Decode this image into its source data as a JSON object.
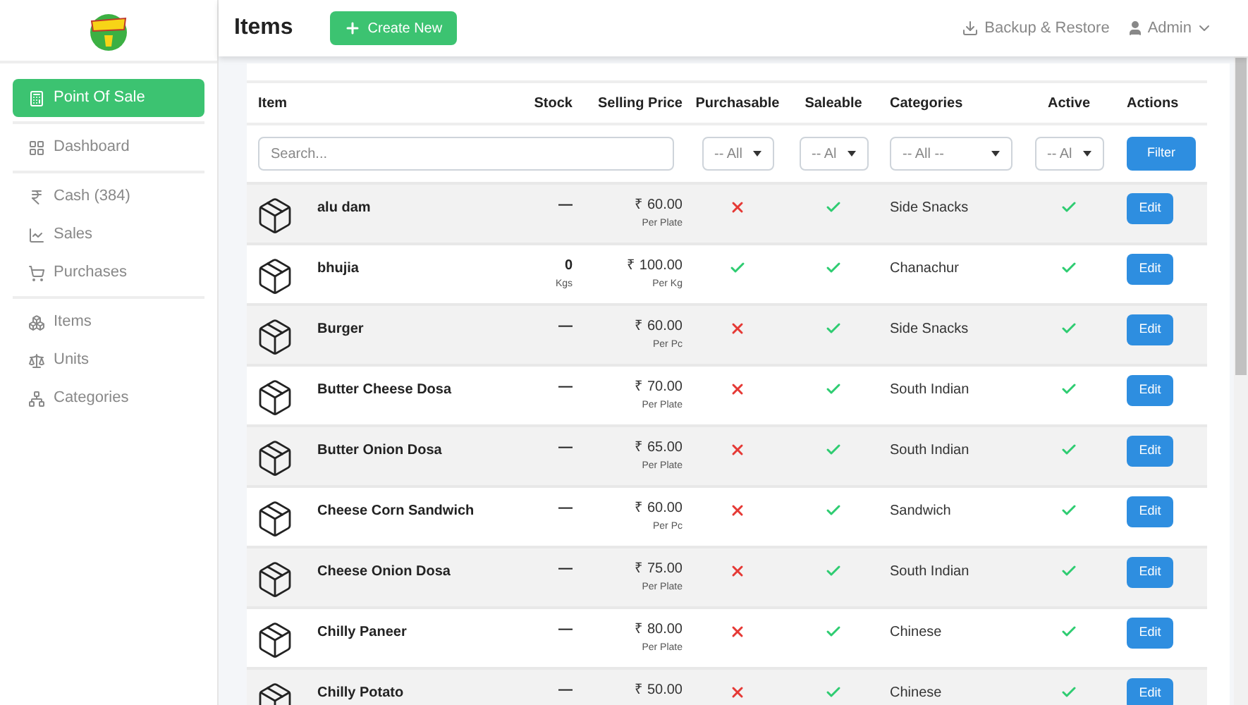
{
  "header": {
    "title": "Items",
    "create_button": "Create New",
    "backup_link": "Backup & Restore",
    "user_menu": "Admin"
  },
  "sidebar": {
    "groups": [
      {
        "items": [
          {
            "label": "Point Of Sale",
            "selected": true
          }
        ]
      },
      {
        "items": [
          {
            "label": "Dashboard",
            "selected": false
          }
        ]
      },
      {
        "items": [
          {
            "label": "Cash (384)",
            "selected": false
          },
          {
            "label": "Sales",
            "selected": false
          },
          {
            "label": "Purchases",
            "selected": false
          }
        ]
      },
      {
        "items": [
          {
            "label": "Items",
            "selected": false
          },
          {
            "label": "Units",
            "selected": false
          },
          {
            "label": "Categories",
            "selected": false
          }
        ]
      }
    ]
  },
  "table": {
    "columns": [
      "Item",
      "Stock",
      "Selling Price",
      "Purchasable",
      "Saleable",
      "Categories",
      "Active",
      "Actions"
    ],
    "filters": {
      "search_placeholder": "Search...",
      "purchasable": "-- All",
      "saleable": "-- Al",
      "categories": "-- All --",
      "active": "-- Al",
      "filter_button": "Filter"
    },
    "rows": [
      {
        "name": "alu dam",
        "stock": "—",
        "price": "₹ 60.00",
        "price_unit": "Per Plate",
        "purchasable": false,
        "saleable": true,
        "category": "Side Snacks",
        "active": true,
        "action": "Edit"
      },
      {
        "name": "bhujia",
        "stock": "0",
        "stock_unit": "Kgs",
        "price": "₹ 100.00",
        "price_unit": "Per Kg",
        "purchasable": true,
        "saleable": true,
        "category": "Chanachur",
        "active": true,
        "action": "Edit"
      },
      {
        "name": "Burger",
        "stock": "—",
        "price": "₹ 60.00",
        "price_unit": "Per Pc",
        "purchasable": false,
        "saleable": true,
        "category": "Side Snacks",
        "active": true,
        "action": "Edit"
      },
      {
        "name": "Butter Cheese Dosa",
        "stock": "—",
        "price": "₹ 70.00",
        "price_unit": "Per Plate",
        "purchasable": false,
        "saleable": true,
        "category": "South Indian",
        "active": true,
        "action": "Edit"
      },
      {
        "name": "Butter Onion Dosa",
        "stock": "—",
        "price": "₹ 65.00",
        "price_unit": "Per Plate",
        "purchasable": false,
        "saleable": true,
        "category": "South Indian",
        "active": true,
        "action": "Edit"
      },
      {
        "name": "Cheese Corn Sandwich",
        "stock": "—",
        "price": "₹ 60.00",
        "price_unit": "Per Pc",
        "purchasable": false,
        "saleable": true,
        "category": "Sandwich",
        "active": true,
        "action": "Edit"
      },
      {
        "name": "Cheese Onion Dosa",
        "stock": "—",
        "price": "₹ 75.00",
        "price_unit": "Per Plate",
        "purchasable": false,
        "saleable": true,
        "category": "South Indian",
        "active": true,
        "action": "Edit"
      },
      {
        "name": "Chilly Paneer",
        "stock": "—",
        "price": "₹ 80.00",
        "price_unit": "Per Plate",
        "purchasable": false,
        "saleable": true,
        "category": "Chinese",
        "active": true,
        "action": "Edit"
      },
      {
        "name": "Chilly Potato",
        "stock": "—",
        "price": "₹ 50.00",
        "purchasable": false,
        "saleable": true,
        "category": "Chinese",
        "active": true,
        "action": "Edit"
      }
    ]
  }
}
